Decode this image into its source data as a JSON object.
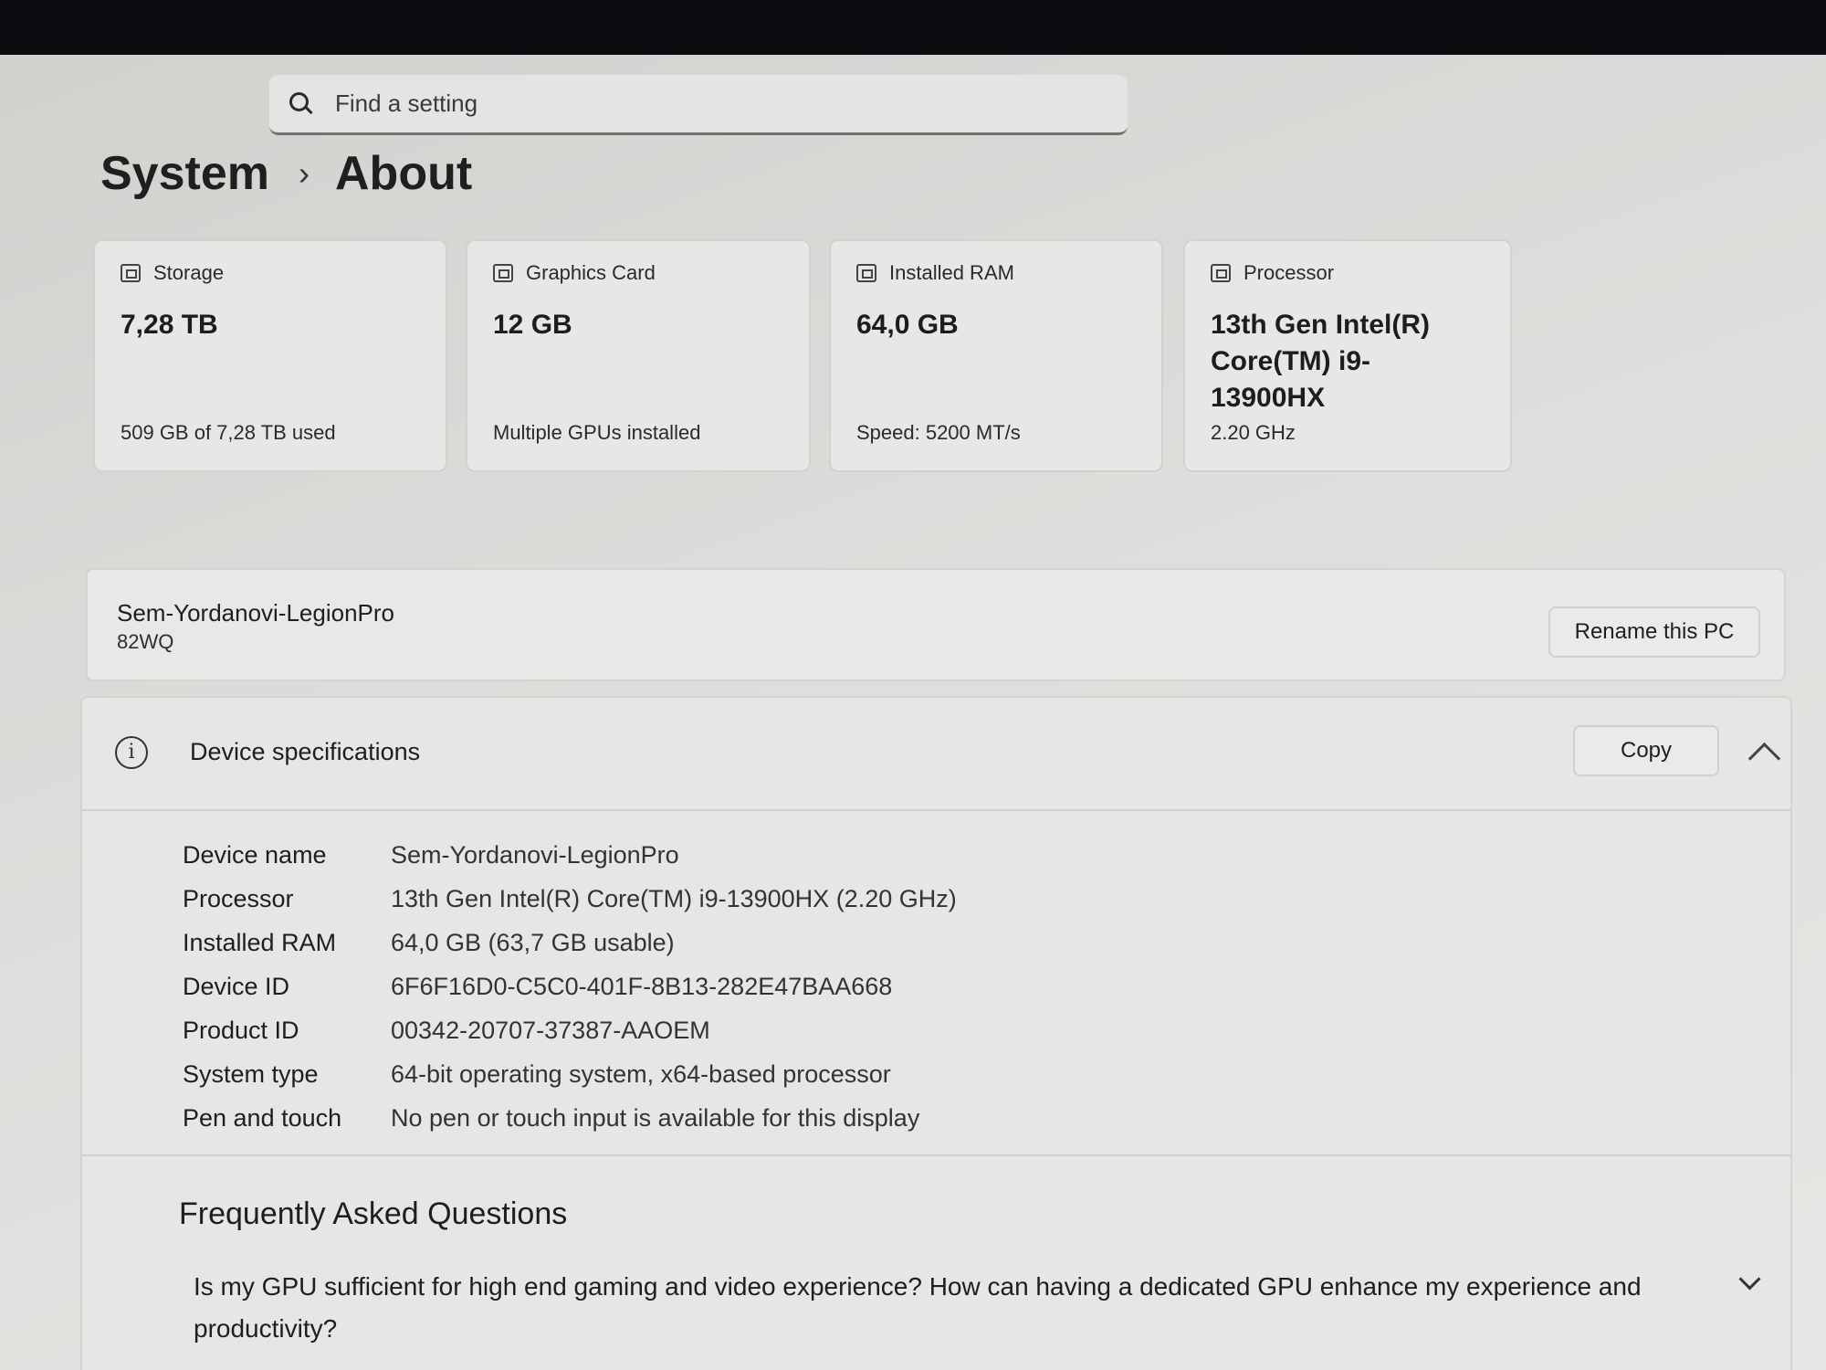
{
  "search": {
    "placeholder": "Find a setting",
    "icon": "search-icon"
  },
  "breadcrumb": {
    "parent": "System",
    "separator": "›",
    "current": "About"
  },
  "cards": [
    {
      "title": "Storage",
      "value": "7,28 TB",
      "sub": "509 GB of 7,28 TB used",
      "icon": "storage-icon"
    },
    {
      "title": "Graphics Card",
      "value": "12 GB",
      "sub": "Multiple GPUs installed",
      "icon": "graphics-card-icon"
    },
    {
      "title": "Installed RAM",
      "value": "64,0 GB",
      "sub": "Speed: 5200 MT/s",
      "icon": "ram-icon"
    },
    {
      "title": "Processor",
      "value": "13th Gen Intel(R) Core(TM) i9-13900HX",
      "sub": "2.20 GHz",
      "icon": "processor-icon"
    }
  ],
  "pc": {
    "name": "Sem-Yordanovi-LegionPro",
    "model": "82WQ",
    "rename_label": "Rename this PC"
  },
  "specs": {
    "title": "Device specifications",
    "copy_label": "Copy",
    "rows": [
      {
        "label": "Device name",
        "value": "Sem-Yordanovi-LegionPro"
      },
      {
        "label": "Processor",
        "value": "13th Gen Intel(R) Core(TM) i9-13900HX (2.20 GHz)"
      },
      {
        "label": "Installed RAM",
        "value": "64,0 GB (63,7 GB usable)"
      },
      {
        "label": "Device ID",
        "value": "6F6F16D0-C5C0-401F-8B13-282E47BAA668"
      },
      {
        "label": "Product ID",
        "value": "00342-20707-37387-AAOEM"
      },
      {
        "label": "System type",
        "value": "64-bit operating system, x64-based processor"
      },
      {
        "label": "Pen and touch",
        "value": "No pen or touch input is available for this display"
      }
    ]
  },
  "faq": {
    "title": "Frequently Asked Questions",
    "question": "Is my GPU sufficient for high end gaming and video experience? How can having a dedicated GPU enhance my experience and productivity?"
  }
}
